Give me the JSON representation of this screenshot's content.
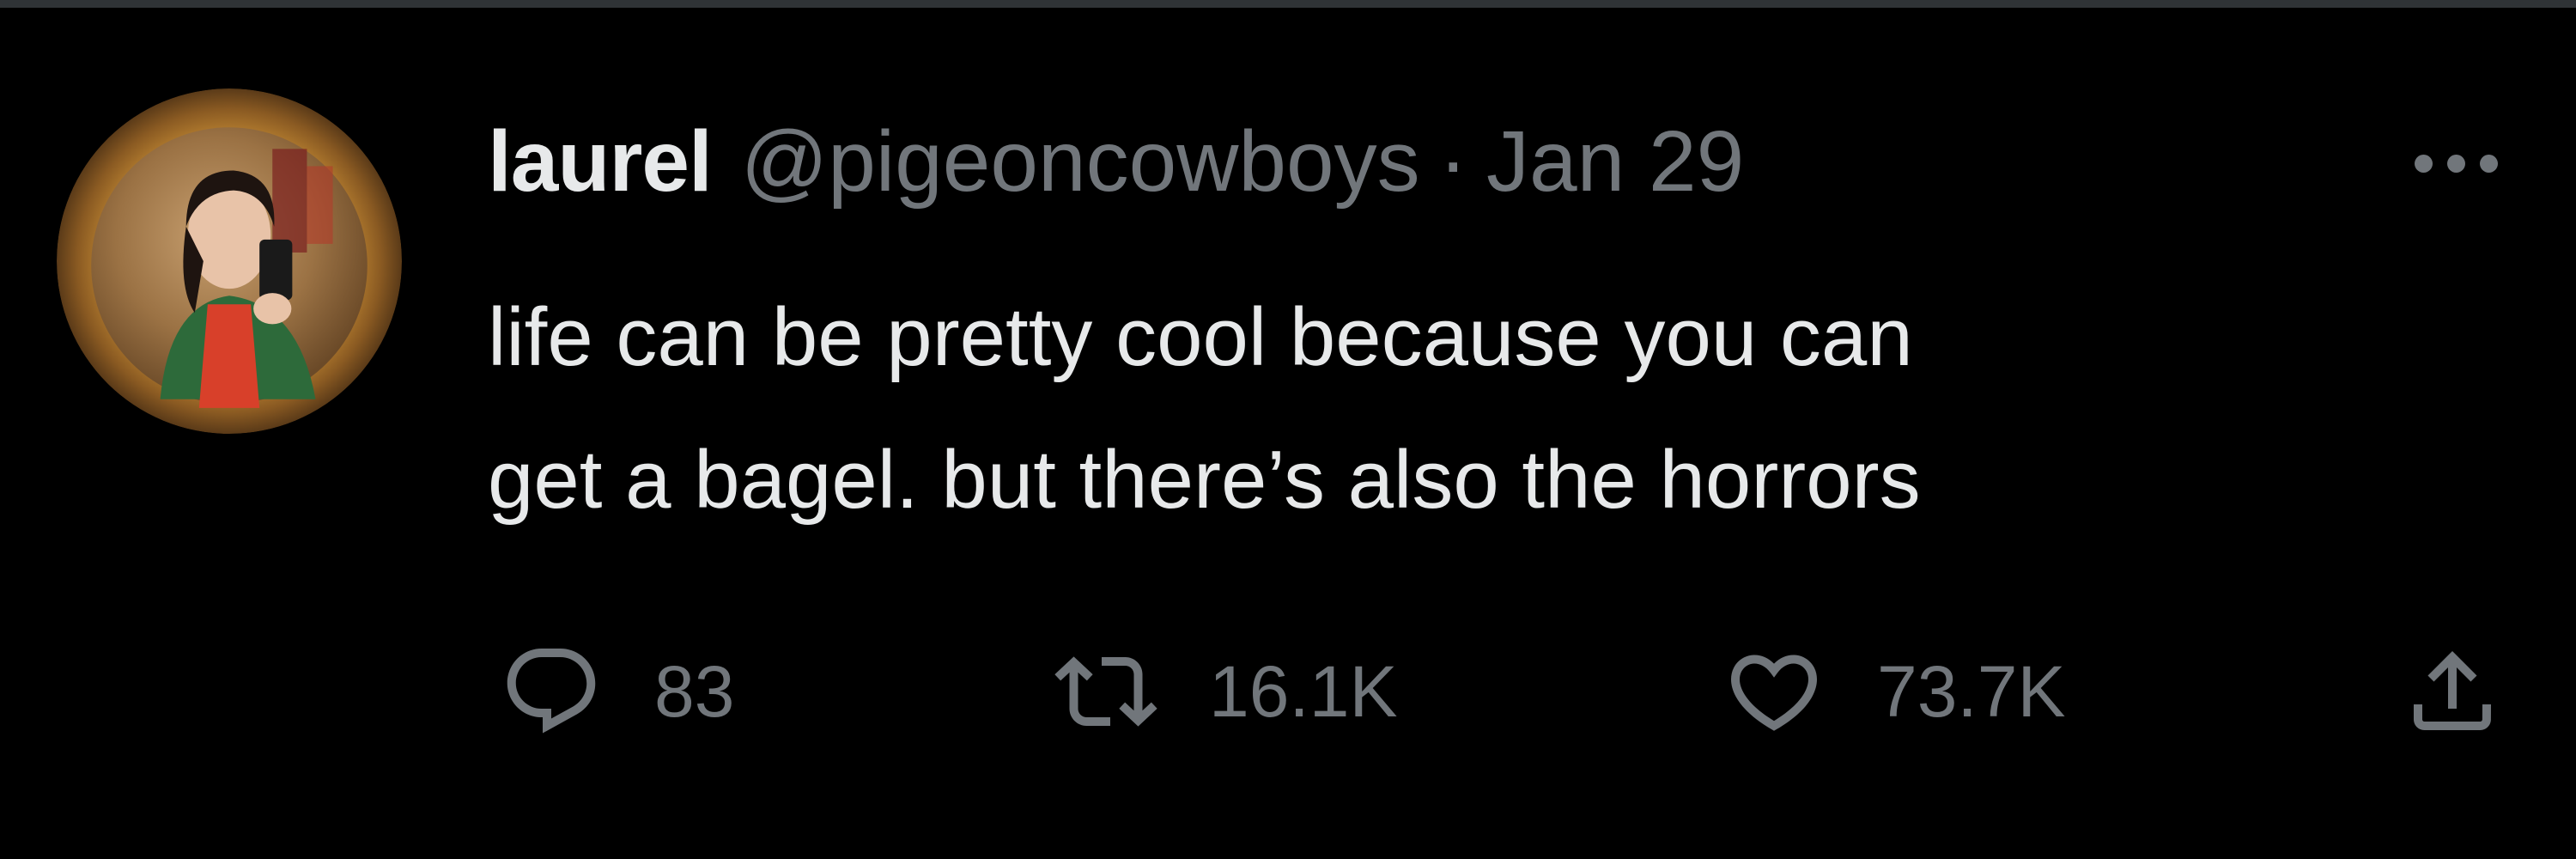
{
  "tweet": {
    "author": {
      "display_name": "laurel",
      "handle": "@pigeoncowboys"
    },
    "separator": "·",
    "date": "Jan 29",
    "text_lines": [
      "life can be pretty cool because you can",
      "get a bagel. but there’s also the horrors"
    ],
    "actions": {
      "replies": "83",
      "reposts": "16.1K",
      "likes": "73.7K"
    }
  },
  "icons": {
    "more": "more-horizontal-icon",
    "reply": "speech-bubble-icon",
    "repost": "repost-arrows-icon",
    "like": "heart-icon",
    "share": "share-upload-icon"
  },
  "colors": {
    "background": "#000000",
    "primary_text": "#e7e9ea",
    "secondary_text": "#71767b",
    "divider": "#2f3336"
  }
}
